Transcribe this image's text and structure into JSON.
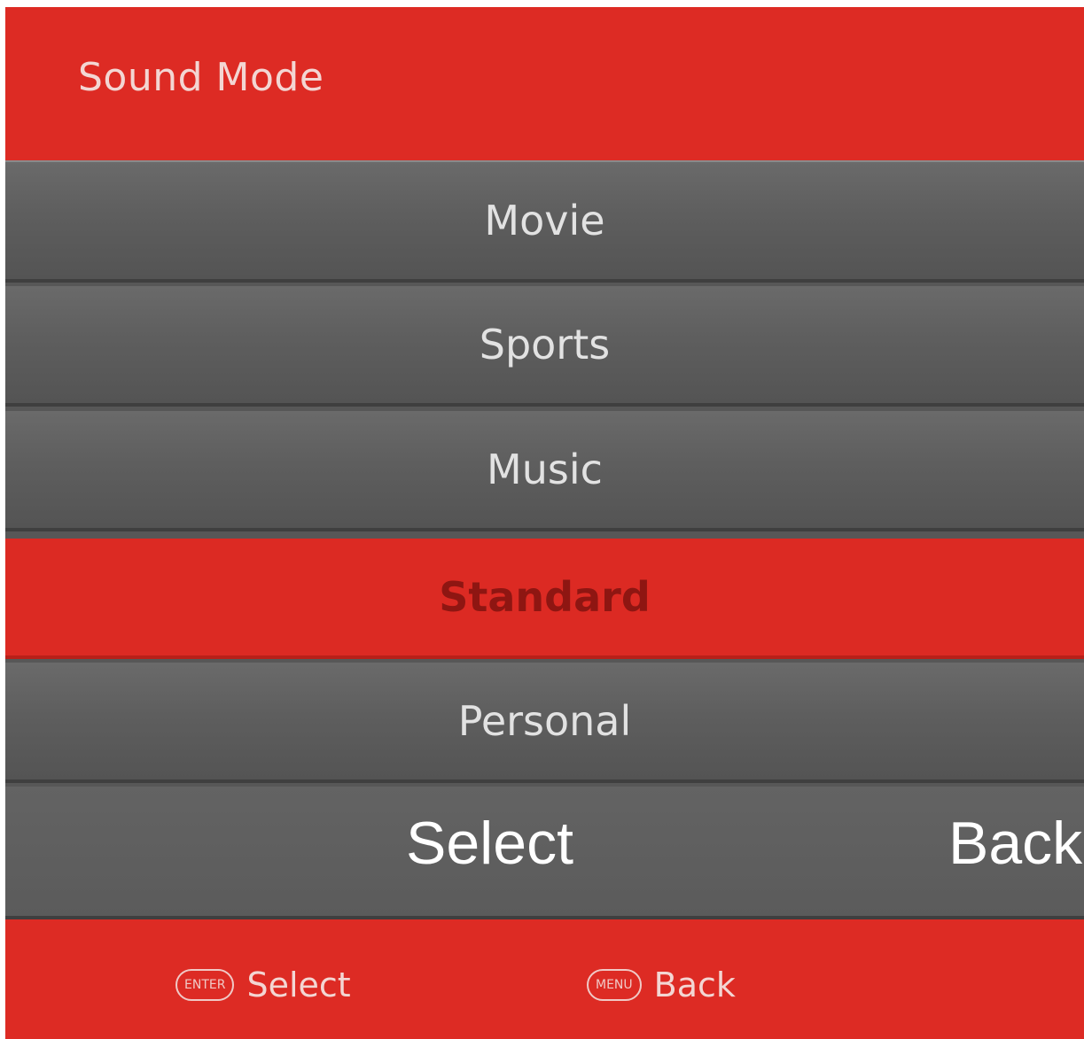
{
  "header": {
    "title": "Sound Mode"
  },
  "menu": {
    "items": [
      {
        "label": "Movie"
      },
      {
        "label": "Sports"
      },
      {
        "label": "Music"
      },
      {
        "label": "Standard",
        "selected": true
      },
      {
        "label": "Personal"
      }
    ]
  },
  "overlay": {
    "select_label": "Select",
    "back_label": "Back"
  },
  "footer": {
    "enter_key": "ENTER",
    "select_label": "Select",
    "menu_key": "MENU",
    "back_label": "Back"
  },
  "colors": {
    "accent_red": "#dd2b24",
    "item_gray": "#5e5e5e",
    "selected_text": "#8e1612"
  }
}
